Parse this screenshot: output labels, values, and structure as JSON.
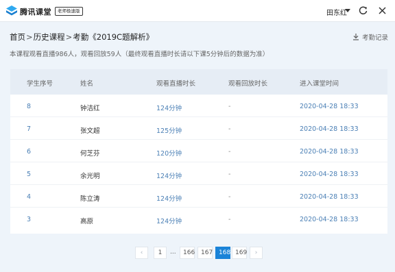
{
  "titlebar": {
    "app_name": "腾讯课堂",
    "edition": "老师极速版",
    "user_name": "田东红"
  },
  "header": {
    "breadcrumb": [
      "首页",
      "历史课程",
      "考勤《2019C题解析》"
    ],
    "record_label": "考勤记录",
    "summary": "本课程观看直播986人，观看回放59人（最终观看直播时长请以下课5分钟后的数据为准）"
  },
  "table": {
    "columns": [
      "学生序号",
      "姓名",
      "观看直播时长",
      "观看回放时长",
      "进入课堂时间"
    ],
    "rows": [
      {
        "seq": "8",
        "name": "钟洁红",
        "live": "124分钟",
        "replay": "-",
        "time": "2020-04-28 18:33"
      },
      {
        "seq": "7",
        "name": "张文超",
        "live": "125分钟",
        "replay": "-",
        "time": "2020-04-28 18:33"
      },
      {
        "seq": "6",
        "name": "何芝芬",
        "live": "120分钟",
        "replay": "-",
        "time": "2020-04-28 18:33"
      },
      {
        "seq": "5",
        "name": "余光明",
        "live": "124分钟",
        "replay": "-",
        "time": "2020-04-28 18:33"
      },
      {
        "seq": "4",
        "name": "陈立涛",
        "live": "124分钟",
        "replay": "-",
        "time": "2020-04-28 18:33"
      },
      {
        "seq": "3",
        "name": "高原",
        "live": "124分钟",
        "replay": "-",
        "time": "2020-04-28 18:33"
      }
    ]
  },
  "pagination": {
    "prev": "‹",
    "first": "1",
    "ellipsis": "...",
    "pages": [
      "166",
      "167",
      "168",
      "169"
    ],
    "current": "168",
    "next": "›"
  },
  "colors": {
    "accent": "#1a83d8",
    "link_text": "#4a7fb5",
    "header_bg": "#e6edf5",
    "page_bg": "#eef4fa"
  }
}
